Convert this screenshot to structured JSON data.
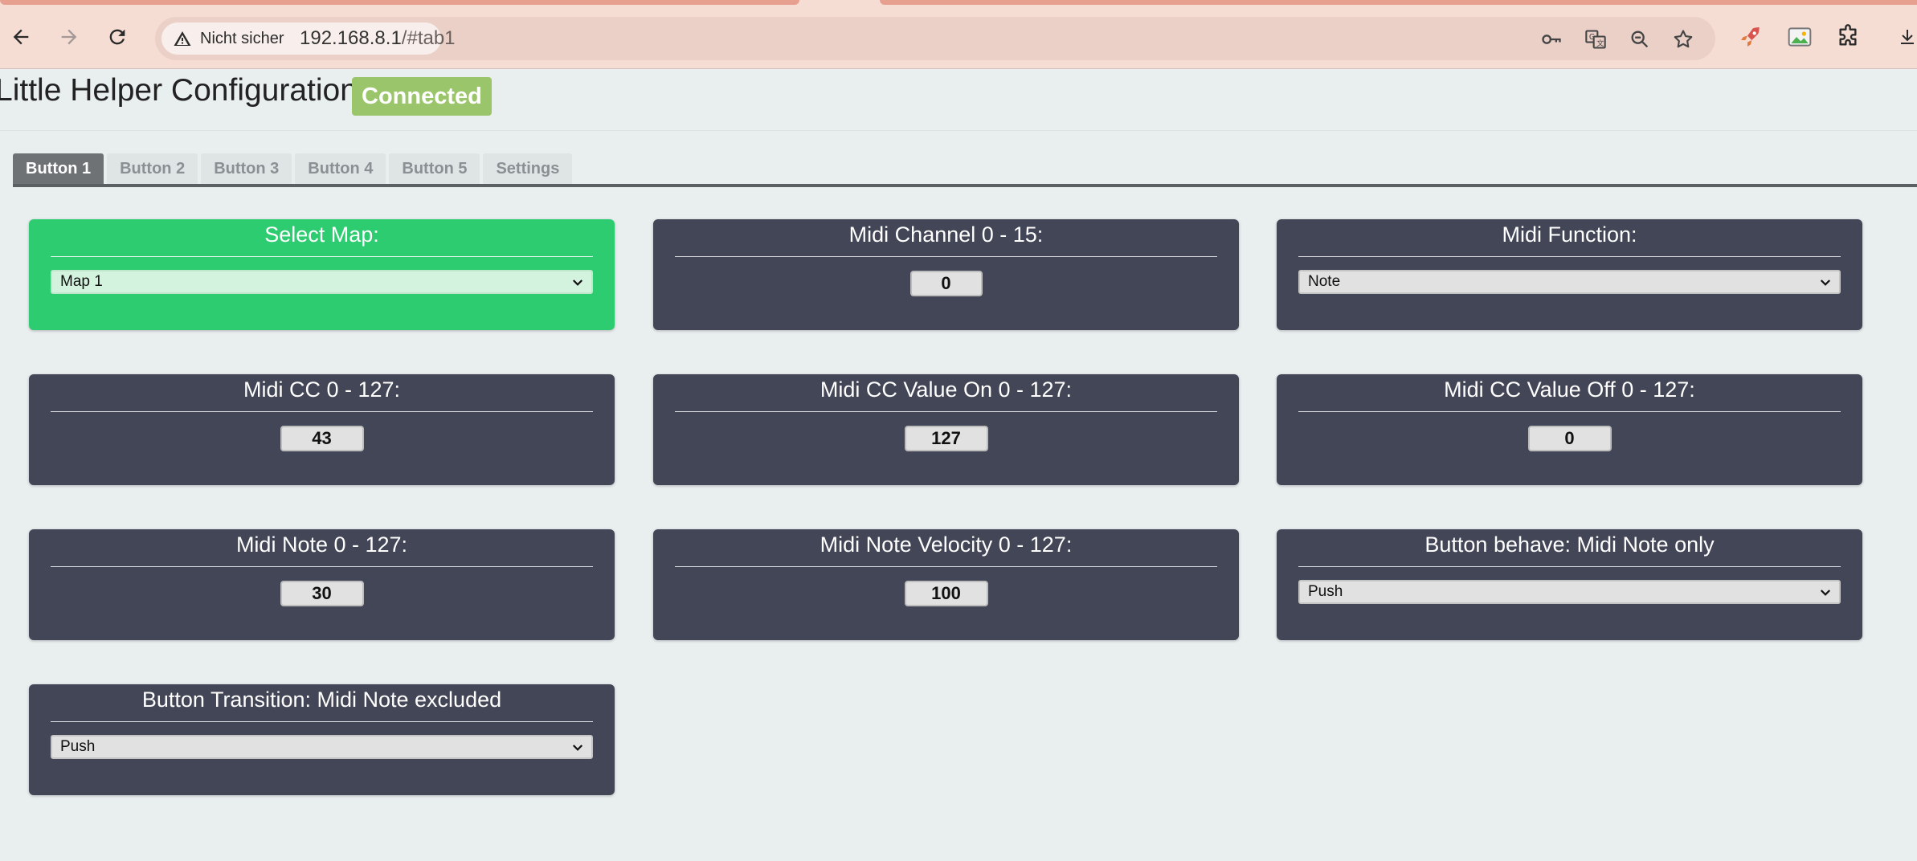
{
  "browser": {
    "security_label": "Nicht sicher",
    "url_host": "192.168.8.1",
    "url_path": "/#tab1"
  },
  "page": {
    "title": "Little Helper Configuration",
    "status": "Connected"
  },
  "tabs": [
    {
      "label": "Button 1",
      "active": true
    },
    {
      "label": "Button 2",
      "active": false
    },
    {
      "label": "Button 3",
      "active": false
    },
    {
      "label": "Button 4",
      "active": false
    },
    {
      "label": "Button 5",
      "active": false
    },
    {
      "label": "Settings",
      "active": false
    }
  ],
  "cards": {
    "select_map": {
      "title": "Select Map:",
      "value": "Map 1"
    },
    "midi_channel": {
      "title": "Midi Channel 0 - 15:",
      "value": "0"
    },
    "midi_function": {
      "title": "Midi Function:",
      "value": "Note"
    },
    "midi_cc": {
      "title": "Midi CC 0 - 127:",
      "value": "43"
    },
    "midi_cc_on": {
      "title": "Midi CC Value On 0 - 127:",
      "value": "127"
    },
    "midi_cc_off": {
      "title": "Midi CC Value Off 0 - 127:",
      "value": "0"
    },
    "midi_note": {
      "title": "Midi Note 0 - 127:",
      "value": "30"
    },
    "midi_note_velocity": {
      "title": "Midi Note Velocity 0 - 127:",
      "value": "100"
    },
    "button_behave": {
      "title": "Button behave: Midi Note only",
      "value": "Push"
    },
    "button_transition": {
      "title": "Button Transition: Midi Note excluded",
      "value": "Push"
    }
  },
  "colors": {
    "card_bg": "#434656",
    "card_highlight": "#2ecc71",
    "status_badge": "#9bc56a",
    "active_tab": "#6e7275"
  }
}
